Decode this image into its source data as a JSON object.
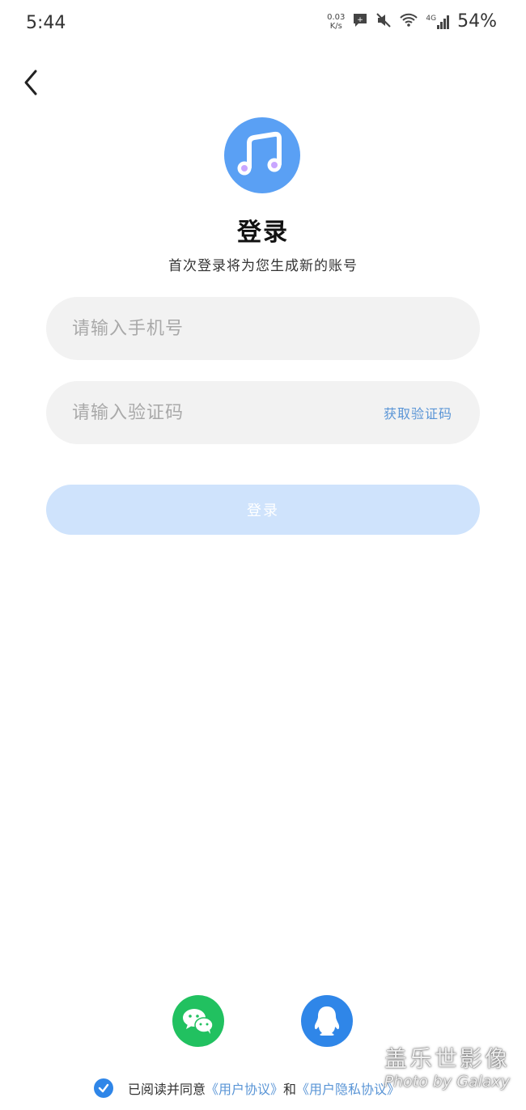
{
  "status_bar": {
    "time": "5:44",
    "net_speed_value": "0.03",
    "net_speed_unit": "K/s",
    "network_type": "4G",
    "battery": "54%",
    "icons": [
      "message-icon",
      "mute-icon",
      "wifi-icon",
      "signal-icon"
    ]
  },
  "header": {
    "back_icon": "chevron-left-icon",
    "logo_icon": "music-note-icon",
    "title": "登录",
    "subtitle": "首次登录将为您生成新的账号"
  },
  "form": {
    "phone_placeholder": "请输入手机号",
    "code_placeholder": "请输入验证码",
    "get_code_label": "获取验证码",
    "login_label": "登录"
  },
  "social": {
    "items": [
      {
        "name": "wechat",
        "icon": "wechat-icon",
        "color": "#21c160"
      },
      {
        "name": "qq",
        "icon": "qq-icon",
        "color": "#2f86e8"
      }
    ]
  },
  "agreement": {
    "checked": true,
    "prefix": "已阅读并同意",
    "user_agreement": "《用户协议》",
    "conjunction": "和",
    "privacy_agreement": "《用户隐私协议》"
  },
  "watermark": {
    "line1": "盖乐世影像",
    "line2": "Photo by Galaxy"
  },
  "colors": {
    "accent": "#5aa0f4",
    "link": "#5a95d6",
    "login_disabled": "#cfe3fc",
    "input_bg": "#f2f2f2"
  }
}
